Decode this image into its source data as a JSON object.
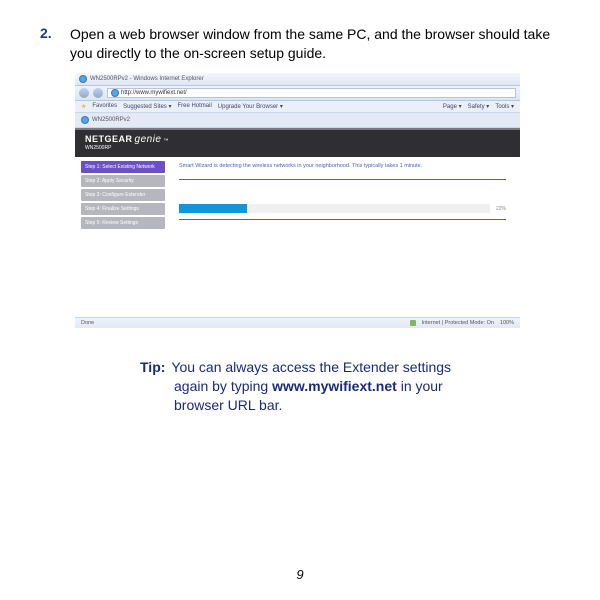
{
  "step": {
    "number": "2.",
    "text": "Open a web browser window from the same PC, and the browser should take you directly to the on-screen setup guide."
  },
  "browser": {
    "title": "WN2500RPv2 - Windows Internet Explorer",
    "address": "http://www.mywifiext.net/",
    "fav_label": "Favorites",
    "fav_item1": "Suggested Sites ▾",
    "fav_item2": "Free Hotmail",
    "fav_item3": "Upgrade Your Browser ▾",
    "menu1": "Page ▾",
    "menu2": "Safety ▾",
    "menu3": "Tools ▾",
    "tab": "WN2500RPv2",
    "brand": "NETGEAR",
    "genie": "genie",
    "tm": "™",
    "model": "WN2500RP",
    "nav1": "Step 1: Select Existing Network",
    "nav2": "Step 2: Apply Security",
    "nav3": "Step 3: Configure Extender",
    "nav4": "Step 4: Finalize Settings",
    "nav5": "Step 5: Review Settings",
    "detect": "Smart Wizard is detecting the wireless networks in your neighborhood. This typically takes 1 minute.",
    "pct": "22%",
    "status_left": "Done",
    "status_mode": "Internet | Protected Mode: On",
    "status_zoom": "100%"
  },
  "tip": {
    "label": "Tip:",
    "line1": "You can always access the Extender settings",
    "line2_a": "again by typing ",
    "line2_bold": "www.mywifiext.net",
    "line2_b": " in your",
    "line3": "browser URL bar."
  },
  "page_number": "9"
}
